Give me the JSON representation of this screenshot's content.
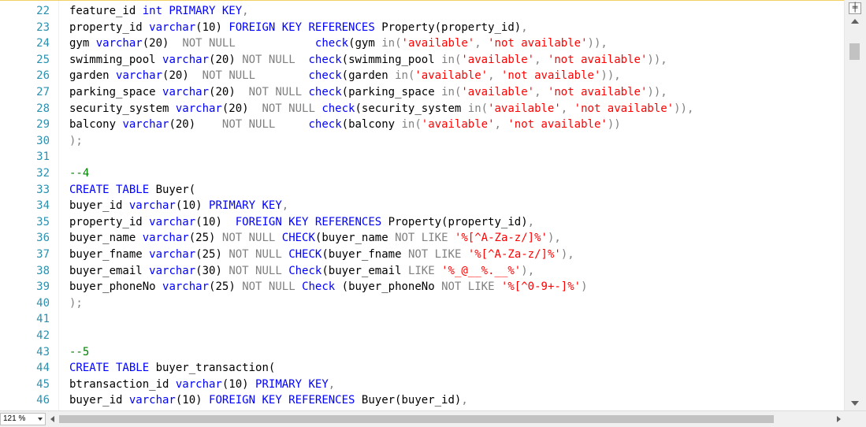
{
  "editor": {
    "lines": [
      {
        "n": "22",
        "t": [
          [
            "feature_id ",
            ""
          ],
          [
            "int PRIMARY KEY",
            "kw"
          ],
          [
            ",",
            "gr"
          ]
        ]
      },
      {
        "n": "23",
        "t": [
          [
            "property_id ",
            ""
          ],
          [
            "varchar",
            "kw"
          ],
          [
            "(10) ",
            ""
          ],
          [
            "FOREIGN KEY REFERENCES ",
            "kw"
          ],
          [
            "Property(property_id)",
            ""
          ],
          [
            ",",
            "gr"
          ]
        ]
      },
      {
        "n": "24",
        "t": [
          [
            "gym ",
            ""
          ],
          [
            "varchar",
            "kw"
          ],
          [
            "(20)  ",
            ""
          ],
          [
            "NOT NULL",
            "gr"
          ],
          [
            "            ",
            ""
          ],
          [
            "check",
            "kw"
          ],
          [
            "(gym ",
            ""
          ],
          [
            "in",
            "gr"
          ],
          [
            "(",
            "gr"
          ],
          [
            "'available'",
            "st"
          ],
          [
            ", ",
            "gr"
          ],
          [
            "'not available'",
            "st"
          ],
          [
            "))",
            "gr"
          ],
          [
            ",",
            "gr"
          ]
        ]
      },
      {
        "n": "25",
        "t": [
          [
            "swimming_pool ",
            ""
          ],
          [
            "varchar",
            "kw"
          ],
          [
            "(20) ",
            ""
          ],
          [
            "NOT NULL",
            "gr"
          ],
          [
            "  ",
            ""
          ],
          [
            "check",
            "kw"
          ],
          [
            "(swimming_pool ",
            ""
          ],
          [
            "in",
            "gr"
          ],
          [
            "(",
            "gr"
          ],
          [
            "'available'",
            "st"
          ],
          [
            ", ",
            "gr"
          ],
          [
            "'not available'",
            "st"
          ],
          [
            "))",
            "gr"
          ],
          [
            ",",
            "gr"
          ]
        ]
      },
      {
        "n": "26",
        "t": [
          [
            "garden ",
            ""
          ],
          [
            "varchar",
            "kw"
          ],
          [
            "(20)  ",
            ""
          ],
          [
            "NOT NULL",
            "gr"
          ],
          [
            "        ",
            ""
          ],
          [
            "check",
            "kw"
          ],
          [
            "(garden ",
            ""
          ],
          [
            "in",
            "gr"
          ],
          [
            "(",
            "gr"
          ],
          [
            "'available'",
            "st"
          ],
          [
            ", ",
            "gr"
          ],
          [
            "'not available'",
            "st"
          ],
          [
            "))",
            "gr"
          ],
          [
            ",",
            "gr"
          ]
        ]
      },
      {
        "n": "27",
        "t": [
          [
            "parking_space ",
            ""
          ],
          [
            "varchar",
            "kw"
          ],
          [
            "(20)  ",
            ""
          ],
          [
            "NOT NULL",
            "gr"
          ],
          [
            " ",
            ""
          ],
          [
            "check",
            "kw"
          ],
          [
            "(parking_space ",
            ""
          ],
          [
            "in",
            "gr"
          ],
          [
            "(",
            "gr"
          ],
          [
            "'available'",
            "st"
          ],
          [
            ", ",
            "gr"
          ],
          [
            "'not available'",
            "st"
          ],
          [
            "))",
            "gr"
          ],
          [
            ",",
            "gr"
          ]
        ]
      },
      {
        "n": "28",
        "t": [
          [
            "security_system ",
            ""
          ],
          [
            "varchar",
            "kw"
          ],
          [
            "(20)  ",
            ""
          ],
          [
            "NOT NULL",
            "gr"
          ],
          [
            " ",
            ""
          ],
          [
            "check",
            "kw"
          ],
          [
            "(security_system ",
            ""
          ],
          [
            "in",
            "gr"
          ],
          [
            "(",
            "gr"
          ],
          [
            "'available'",
            "st"
          ],
          [
            ", ",
            "gr"
          ],
          [
            "'not available'",
            "st"
          ],
          [
            "))",
            "gr"
          ],
          [
            ",",
            "gr"
          ]
        ]
      },
      {
        "n": "29",
        "t": [
          [
            "balcony ",
            ""
          ],
          [
            "varchar",
            "kw"
          ],
          [
            "(20)    ",
            ""
          ],
          [
            "NOT NULL",
            "gr"
          ],
          [
            "     ",
            ""
          ],
          [
            "check",
            "kw"
          ],
          [
            "(balcony ",
            ""
          ],
          [
            "in",
            "gr"
          ],
          [
            "(",
            "gr"
          ],
          [
            "'available'",
            "st"
          ],
          [
            ", ",
            "gr"
          ],
          [
            "'not available'",
            "st"
          ],
          [
            "))",
            "gr"
          ]
        ]
      },
      {
        "n": "30",
        "t": [
          [
            ");",
            "gr"
          ]
        ]
      },
      {
        "n": "31",
        "t": []
      },
      {
        "n": "32",
        "t": [
          [
            "--4",
            "cm"
          ]
        ]
      },
      {
        "n": "33",
        "t": [
          [
            "CREATE TABLE ",
            "kw"
          ],
          [
            "Buyer(",
            ""
          ]
        ]
      },
      {
        "n": "34",
        "t": [
          [
            "buyer_id ",
            ""
          ],
          [
            "varchar",
            "kw"
          ],
          [
            "(10) ",
            ""
          ],
          [
            "PRIMARY KEY",
            "kw"
          ],
          [
            ",",
            "gr"
          ]
        ]
      },
      {
        "n": "35",
        "t": [
          [
            "property_id ",
            ""
          ],
          [
            "varchar",
            "kw"
          ],
          [
            "(10)  ",
            ""
          ],
          [
            "FOREIGN KEY REFERENCES ",
            "kw"
          ],
          [
            "Property(property_id)",
            ""
          ],
          [
            ",",
            "gr"
          ]
        ]
      },
      {
        "n": "36",
        "t": [
          [
            "buyer_name ",
            ""
          ],
          [
            "varchar",
            "kw"
          ],
          [
            "(25) ",
            ""
          ],
          [
            "NOT NULL",
            "gr"
          ],
          [
            " ",
            ""
          ],
          [
            "CHECK",
            "kw"
          ],
          [
            "(buyer_name ",
            ""
          ],
          [
            "NOT LIKE",
            "gr"
          ],
          [
            " ",
            ""
          ],
          [
            "'%[^A-Za-z/]%'",
            "st"
          ],
          [
            ")",
            "gr"
          ],
          [
            ",",
            "gr"
          ]
        ]
      },
      {
        "n": "37",
        "t": [
          [
            "buyer_fname ",
            ""
          ],
          [
            "varchar",
            "kw"
          ],
          [
            "(25) ",
            ""
          ],
          [
            "NOT NULL",
            "gr"
          ],
          [
            " ",
            ""
          ],
          [
            "CHECK",
            "kw"
          ],
          [
            "(buyer_fname ",
            ""
          ],
          [
            "NOT LIKE",
            "gr"
          ],
          [
            " ",
            ""
          ],
          [
            "'%[^A-Za-z/]%'",
            "st"
          ],
          [
            ")",
            "gr"
          ],
          [
            ",",
            "gr"
          ]
        ]
      },
      {
        "n": "38",
        "t": [
          [
            "buyer_email ",
            ""
          ],
          [
            "varchar",
            "kw"
          ],
          [
            "(30) ",
            ""
          ],
          [
            "NOT NULL",
            "gr"
          ],
          [
            " ",
            ""
          ],
          [
            "Check",
            "kw"
          ],
          [
            "(buyer_email ",
            ""
          ],
          [
            "LIKE",
            "gr"
          ],
          [
            " ",
            ""
          ],
          [
            "'%_@__%.__%'",
            "st"
          ],
          [
            ")",
            "gr"
          ],
          [
            ",",
            "gr"
          ]
        ]
      },
      {
        "n": "39",
        "t": [
          [
            "buyer_phoneNo ",
            ""
          ],
          [
            "varchar",
            "kw"
          ],
          [
            "(25) ",
            ""
          ],
          [
            "NOT NULL",
            "gr"
          ],
          [
            " ",
            ""
          ],
          [
            "Check",
            "kw"
          ],
          [
            " (buyer_phoneNo ",
            ""
          ],
          [
            "NOT LIKE",
            "gr"
          ],
          [
            " ",
            ""
          ],
          [
            "'%[^0-9+-]%'",
            "st"
          ],
          [
            ")",
            "gr"
          ]
        ]
      },
      {
        "n": "40",
        "t": [
          [
            ");",
            "gr"
          ]
        ]
      },
      {
        "n": "41",
        "t": []
      },
      {
        "n": "42",
        "t": []
      },
      {
        "n": "43",
        "t": [
          [
            "--5",
            "cm"
          ]
        ]
      },
      {
        "n": "44",
        "t": [
          [
            "CREATE TABLE ",
            "kw"
          ],
          [
            "buyer_transaction(",
            ""
          ]
        ]
      },
      {
        "n": "45",
        "t": [
          [
            "btransaction_id ",
            ""
          ],
          [
            "varchar",
            "kw"
          ],
          [
            "(10) ",
            ""
          ],
          [
            "PRIMARY KEY",
            "kw"
          ],
          [
            ",",
            "gr"
          ]
        ]
      },
      {
        "n": "46",
        "t": [
          [
            "buyer_id ",
            ""
          ],
          [
            "varchar",
            "kw"
          ],
          [
            "(10) ",
            ""
          ],
          [
            "FOREIGN KEY REFERENCES ",
            "kw"
          ],
          [
            "Buyer(buyer_id)",
            ""
          ],
          [
            ",",
            "gr"
          ]
        ]
      }
    ]
  },
  "statusbar": {
    "zoom": "121 %"
  },
  "scrollbar": {
    "split_glyph": "╪"
  }
}
